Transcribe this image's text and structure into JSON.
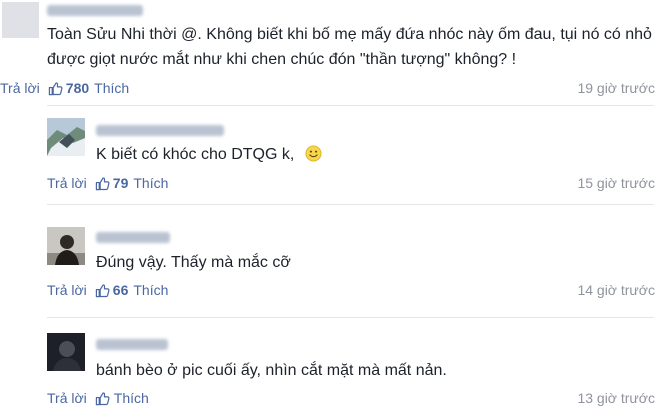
{
  "main_comment": {
    "text": "Toàn Sửu Nhi thời @. Không biết khi bố mẹ mấy đứa nhóc này ốm đau, tụi nó có nhỏ được giọt nước mắt như khi chen chúc đón \"thần tượng\" không? !",
    "reply_label": "Trả lời",
    "like_count": "780",
    "like_label": "Thích",
    "time": "19 giờ trước"
  },
  "replies": [
    {
      "text": "K biết có khóc cho DTQG k,",
      "emoji": "smile-emoji",
      "reply_label": "Trả lời",
      "like_count": "79",
      "like_label": "Thích",
      "time": "15 giờ trước"
    },
    {
      "text": "Đúng vậy. Thấy mà mắc cỡ",
      "reply_label": "Trả lời",
      "like_count": "66",
      "like_label": "Thích",
      "time": "14 giờ trước"
    },
    {
      "text": "bánh bèo ở pic cuối ấy, nhìn cắt mặt mà mất nản.",
      "reply_label": "Trả lời",
      "like_count": "",
      "like_label": "Thích",
      "time": "13 giờ trước"
    }
  ],
  "colors": {
    "link": "#4b67a1",
    "muted": "#90949c",
    "text": "#1d2129",
    "divider": "#e5e6e9"
  }
}
